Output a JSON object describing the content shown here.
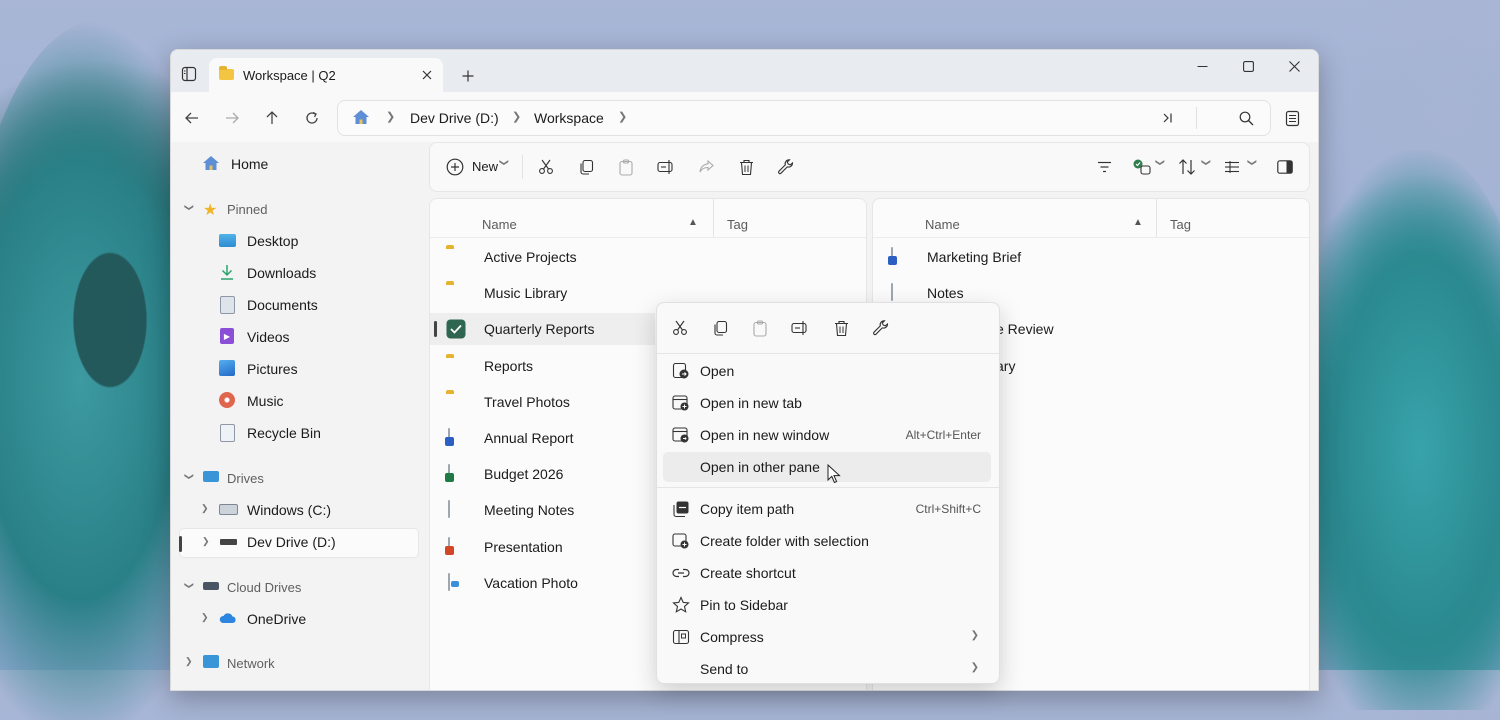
{
  "window": {
    "tab_title": "Workspace | Q2"
  },
  "address_bar": {
    "crumbs": [
      "Dev Drive (D:)",
      "Workspace"
    ]
  },
  "sidebar": {
    "home": "Home",
    "pinned_header": "Pinned",
    "pinned": [
      "Desktop",
      "Downloads",
      "Documents",
      "Videos",
      "Pictures",
      "Music",
      "Recycle Bin"
    ],
    "drives_header": "Drives",
    "drives": [
      "Windows (C:)",
      "Dev Drive (D:)"
    ],
    "cloud_header": "Cloud Drives",
    "cloud": [
      "OneDrive"
    ],
    "network_header": "Network"
  },
  "toolbar": {
    "new_label": "New"
  },
  "left_pane": {
    "columns": {
      "name": "Name",
      "tag": "Tag"
    },
    "rows": [
      {
        "name": "Active Projects",
        "type": "folder"
      },
      {
        "name": "Music Library",
        "type": "folder"
      },
      {
        "name": "Quarterly Reports",
        "type": "folder",
        "selected": true
      },
      {
        "name": "Reports",
        "type": "folder"
      },
      {
        "name": "Travel Photos",
        "type": "folder"
      },
      {
        "name": "Annual Report",
        "type": "word"
      },
      {
        "name": "Budget 2026",
        "type": "excel"
      },
      {
        "name": "Meeting Notes",
        "type": "text"
      },
      {
        "name": "Presentation",
        "type": "powerpoint"
      },
      {
        "name": "Vacation Photo",
        "type": "image"
      }
    ]
  },
  "right_pane": {
    "columns": {
      "name": "Name",
      "tag": "Tag"
    },
    "rows": [
      {
        "name": "Marketing Brief",
        "type": "word"
      },
      {
        "name": "Notes",
        "type": "text"
      },
      {
        "name": "e Review",
        "type": "partial"
      },
      {
        "name": "ary",
        "type": "partial"
      }
    ]
  },
  "context_menu": {
    "items": [
      {
        "label": "Open",
        "shortcut": ""
      },
      {
        "label": "Open in new tab",
        "shortcut": ""
      },
      {
        "label": "Open in new window",
        "shortcut": "Alt+Ctrl+Enter"
      },
      {
        "label": "Open in other pane",
        "shortcut": ""
      },
      {
        "label": "Copy item path",
        "shortcut": "Ctrl+Shift+C"
      },
      {
        "label": "Create folder with selection",
        "shortcut": ""
      },
      {
        "label": "Create shortcut",
        "shortcut": ""
      },
      {
        "label": "Pin to Sidebar",
        "shortcut": ""
      },
      {
        "label": "Compress",
        "shortcut": ""
      },
      {
        "label": "Send to",
        "shortcut": ""
      }
    ]
  }
}
